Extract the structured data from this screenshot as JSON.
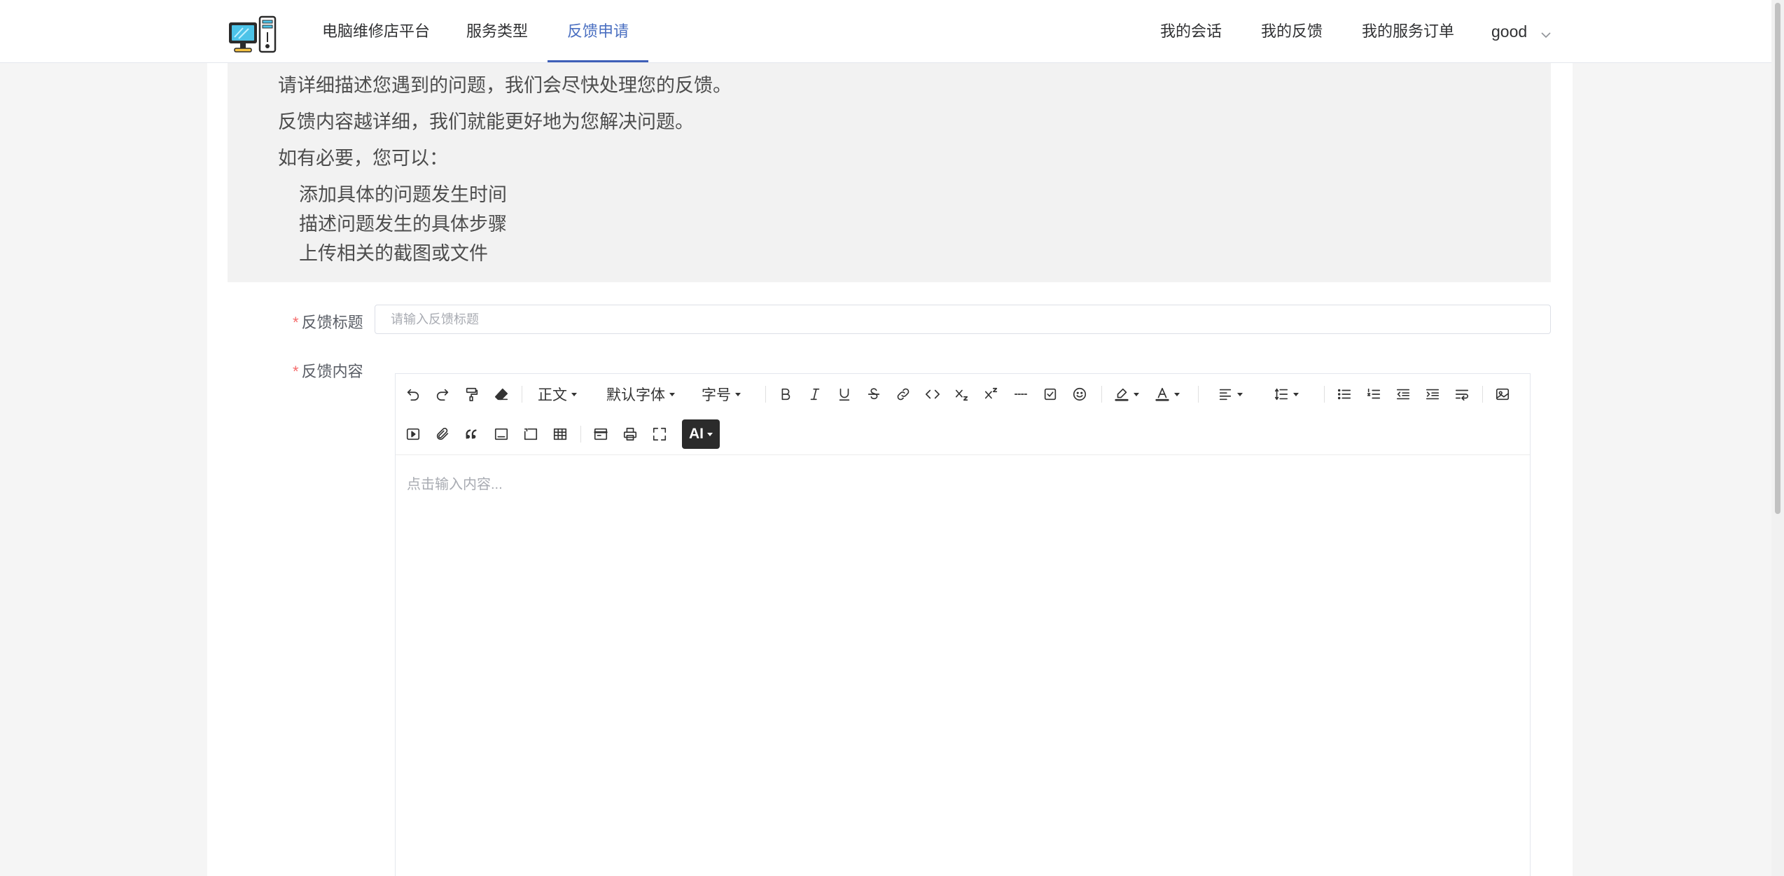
{
  "header": {
    "logo_icon": "computer-repair-logo-icon",
    "nav": [
      {
        "label": "电脑维修店平台",
        "active": false
      },
      {
        "label": "服务类型",
        "active": false
      },
      {
        "label": "反馈申请",
        "active": true
      }
    ],
    "right_nav": [
      {
        "label": "我的会话"
      },
      {
        "label": "我的反馈"
      },
      {
        "label": "我的服务订单"
      }
    ],
    "user": {
      "name": "good",
      "icon": "chevron-down-icon"
    }
  },
  "guide": {
    "lines": [
      "请详细描述您遇到的问题，我们会尽快处理您的反馈。",
      "反馈内容越详细，我们就能更好地为您解决问题。",
      "如有必要，您可以："
    ],
    "tips": [
      "添加具体的问题发生时间",
      "描述问题发生的具体步骤",
      "上传相关的截图或文件"
    ]
  },
  "form": {
    "title_label": "反馈标题",
    "title_placeholder": "请输入反馈标题",
    "title_value": "",
    "content_label": "反馈内容",
    "required_mark": "*"
  },
  "editor": {
    "heading_select": "正文",
    "font_select": "默认字体",
    "size_select": "字号",
    "ai_label": "AI",
    "placeholder": "点击输入内容...",
    "accent": "#3f5fb8"
  }
}
